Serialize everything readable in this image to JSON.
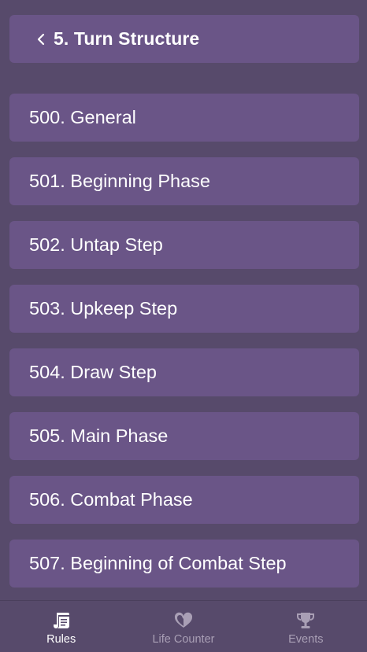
{
  "header": {
    "back_icon": "chevron-left-icon",
    "title": "5. Turn Structure"
  },
  "rules": [
    {
      "label": "500. General"
    },
    {
      "label": "501. Beginning Phase"
    },
    {
      "label": "502. Untap Step"
    },
    {
      "label": "503. Upkeep Step"
    },
    {
      "label": "504. Draw Step"
    },
    {
      "label": "505. Main Phase"
    },
    {
      "label": "506. Combat Phase"
    },
    {
      "label": "507. Beginning of Combat Step"
    }
  ],
  "bottom_nav": {
    "items": [
      {
        "label": "Rules",
        "icon": "scroll-icon",
        "active": true
      },
      {
        "label": "Life Counter",
        "icon": "heart-icon",
        "active": false
      },
      {
        "label": "Events",
        "icon": "trophy-icon",
        "active": false
      }
    ]
  },
  "colors": {
    "background": "#574a6b",
    "card": "#6a5587",
    "text": "#ffffff",
    "inactive": "#a99fb5"
  }
}
